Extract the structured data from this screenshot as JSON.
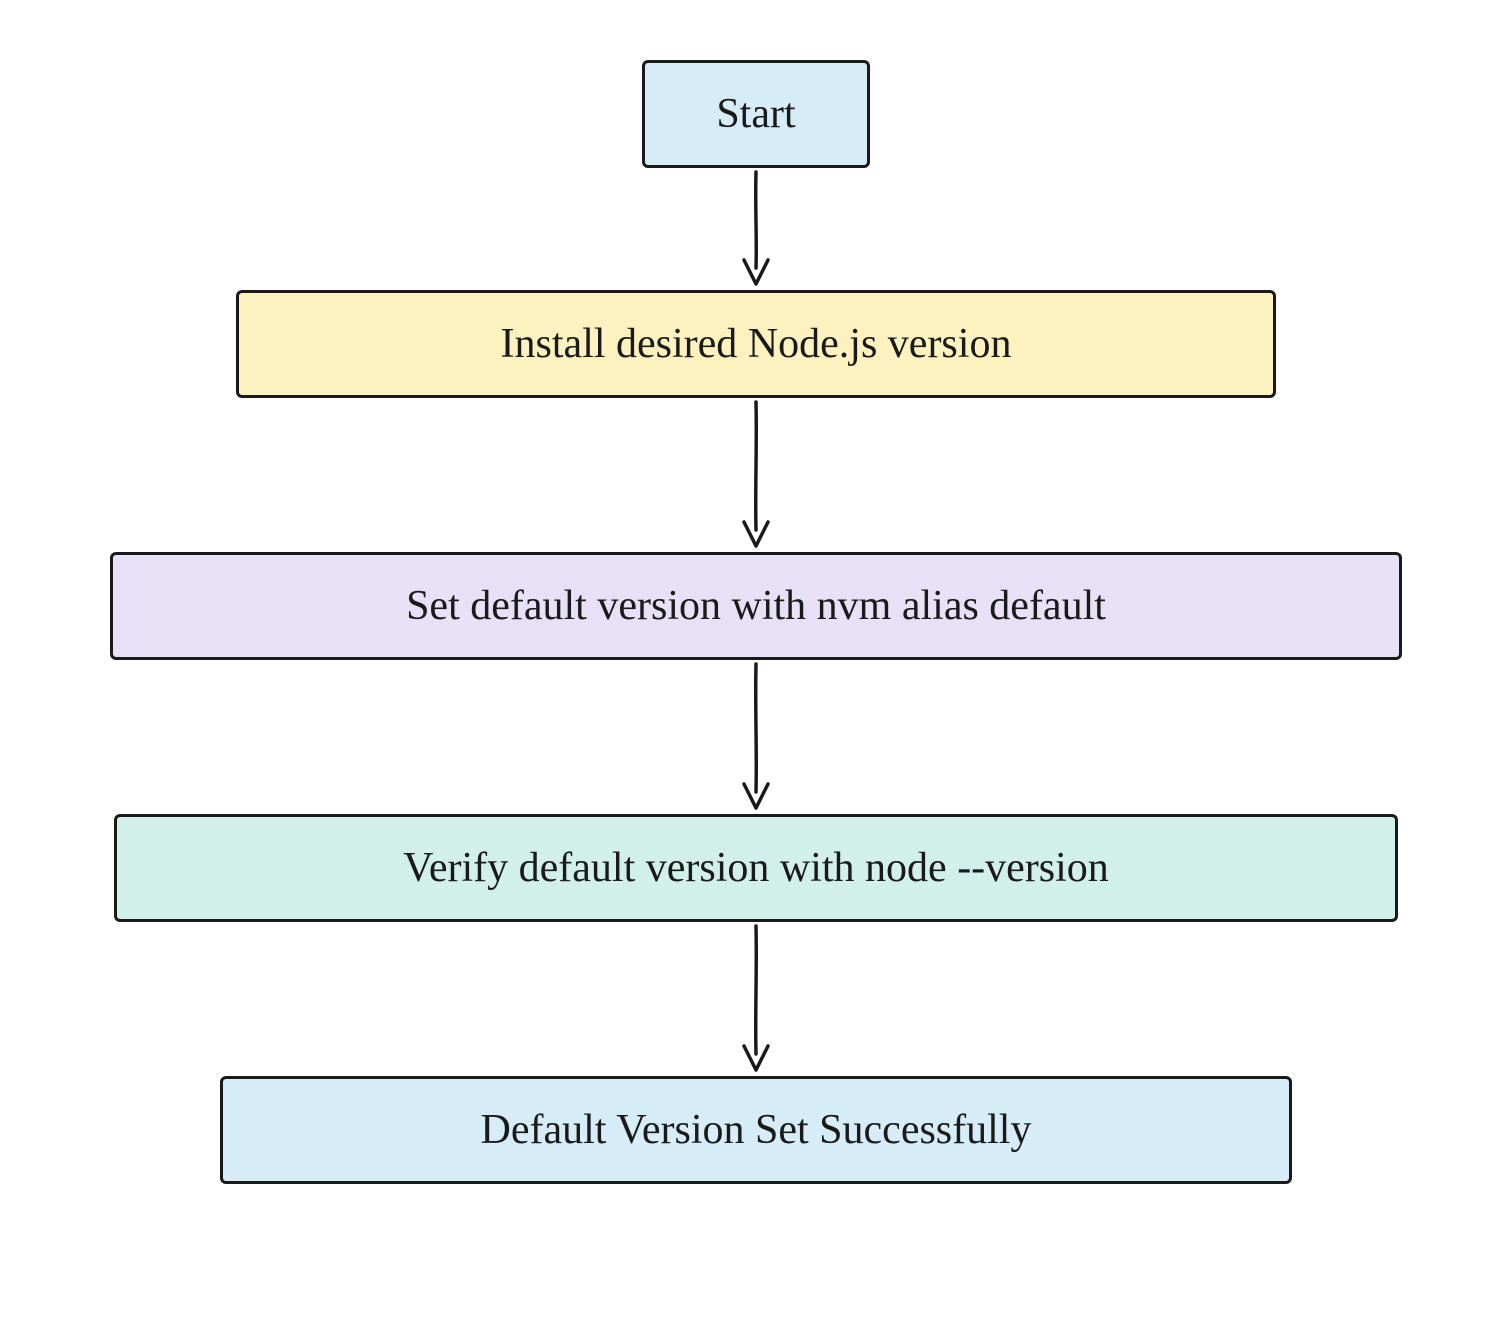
{
  "flow": {
    "nodes": [
      {
        "id": "start",
        "label": "Start",
        "fill": "#d6ecf7"
      },
      {
        "id": "install",
        "label": "Install desired Node.js version",
        "fill": "#fbf2c0"
      },
      {
        "id": "set",
        "label": "Set default version with nvm alias default",
        "fill": "#e7e0f6"
      },
      {
        "id": "verify",
        "label": "Verify default version with node --version",
        "fill": "#d2f0ea"
      },
      {
        "id": "done",
        "label": "Default Version Set Successfully",
        "fill": "#d6ecf7"
      }
    ],
    "edges": [
      {
        "from": "start",
        "to": "install"
      },
      {
        "from": "install",
        "to": "set"
      },
      {
        "from": "set",
        "to": "verify"
      },
      {
        "from": "verify",
        "to": "done"
      }
    ]
  }
}
